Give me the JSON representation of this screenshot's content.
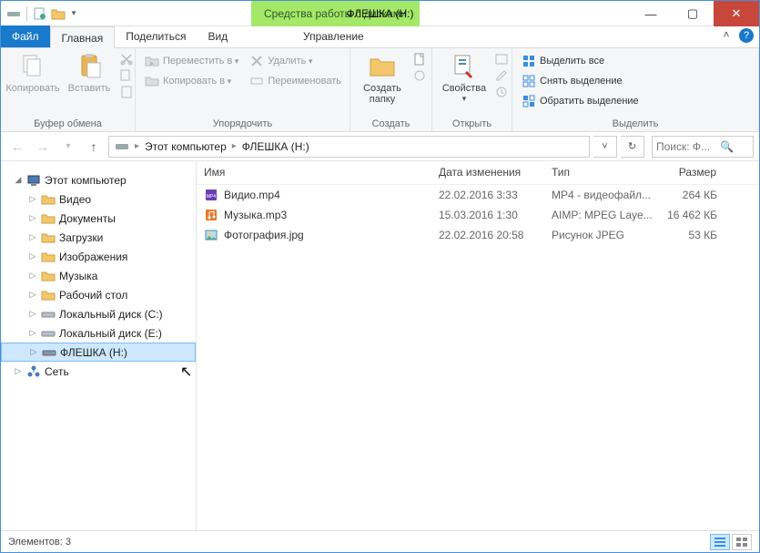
{
  "titlebar": {
    "contextual_tab": "Средства работы с дисками",
    "title": "ФЛЕШКА (H:)",
    "min": "—",
    "max": "▢",
    "close": "✕"
  },
  "tabs": {
    "file": "Файл",
    "home": "Главная",
    "share": "Поделиться",
    "view": "Вид",
    "manage": "Управление"
  },
  "ribbon": {
    "clipboard": {
      "copy": "Копировать",
      "paste": "Вставить",
      "group": "Буфер обмена"
    },
    "organize": {
      "move_to": "Переместить в",
      "copy_to": "Копировать в",
      "delete": "Удалить",
      "rename": "Переименовать",
      "group": "Упорядочить"
    },
    "new": {
      "new_folder": "Создать папку",
      "group": "Создать"
    },
    "open": {
      "properties": "Свойства",
      "group": "Открыть"
    },
    "select": {
      "select_all": "Выделить все",
      "select_none": "Снять выделение",
      "invert": "Обратить выделение",
      "group": "Выделить"
    }
  },
  "breadcrumb": {
    "root": "Этот компьютер",
    "current": "ФЛЕШКА (H:)"
  },
  "search": {
    "placeholder": "Поиск: Ф..."
  },
  "navpane": {
    "root": "Этот компьютер",
    "items": [
      "Видео",
      "Документы",
      "Загрузки",
      "Изображения",
      "Музыка",
      "Рабочий стол",
      "Локальный диск (C:)",
      "Локальный диск (E:)",
      "ФЛЕШКА (H:)"
    ],
    "network": "Сеть"
  },
  "columns": {
    "name": "Имя",
    "date": "Дата изменения",
    "type": "Тип",
    "size": "Размер"
  },
  "files": [
    {
      "name": "Видио.mp4",
      "date": "22.02.2016 3:33",
      "type": "MP4 - видеофайл...",
      "size": "264 КБ",
      "icon": "mp4"
    },
    {
      "name": "Музыка.mp3",
      "date": "15.03.2016 1:30",
      "type": "AIMP: MPEG Laye...",
      "size": "16 462 КБ",
      "icon": "mp3"
    },
    {
      "name": "Фотография.jpg",
      "date": "22.02.2016 20:58",
      "type": "Рисунок JPEG",
      "size": "53 КБ",
      "icon": "jpg"
    }
  ],
  "statusbar": {
    "count_label": "Элементов:",
    "count": "3"
  }
}
